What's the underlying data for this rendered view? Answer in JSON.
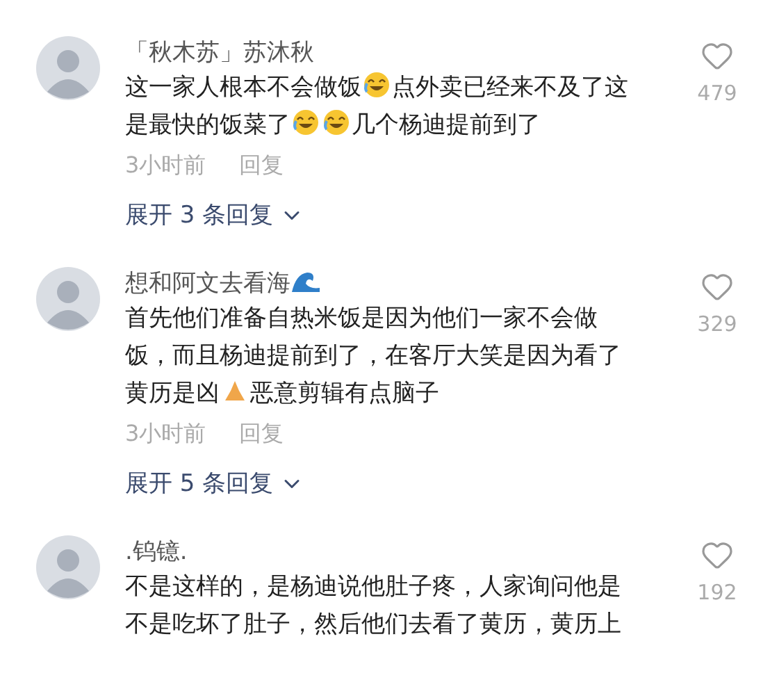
{
  "comments": [
    {
      "username": [
        {
          "kind": "text",
          "text": "「秋木苏」苏沐秋"
        }
      ],
      "lines": [
        [
          {
            "kind": "text",
            "text": "这一家人根本不会做饭"
          },
          {
            "kind": "emoji-laugh"
          },
          {
            "kind": "text",
            "text": "点外卖已经来不及了这"
          }
        ],
        [
          {
            "kind": "text",
            "text": "是最快的饭菜了"
          },
          {
            "kind": "emoji-laugh"
          },
          {
            "kind": "emoji-laugh"
          },
          {
            "kind": "text",
            "text": "几个杨迪提前到了"
          }
        ]
      ],
      "time": "3小时前",
      "reply": "回复",
      "expand": "展开 3 条回复",
      "likes": "479"
    },
    {
      "username": [
        {
          "kind": "text",
          "text": "想和阿文去看海"
        },
        {
          "kind": "emoji-wave"
        }
      ],
      "lines": [
        [
          {
            "kind": "text",
            "text": "首先他们准备自热米饭是因为他们一家不会做"
          }
        ],
        [
          {
            "kind": "text",
            "text": "饭，而且杨迪提前到了，在客厅大笑是因为看了"
          }
        ],
        [
          {
            "kind": "text",
            "text": "黄历是凶"
          },
          {
            "kind": "emoji-pray"
          },
          {
            "kind": "text",
            "text": "恶意剪辑有点脑子"
          }
        ]
      ],
      "time": "3小时前",
      "reply": "回复",
      "expand": "展开 5 条回复",
      "likes": "329"
    },
    {
      "username": [
        {
          "kind": "text",
          "text": ".钨镱."
        }
      ],
      "lines": [
        [
          {
            "kind": "text",
            "text": "不是这样的，是杨迪说他肚子疼，人家询问他是"
          }
        ],
        [
          {
            "kind": "text",
            "text": "不是吃坏了肚子，然后他们去看了黄历，黄历上"
          }
        ]
      ],
      "likes": "192"
    }
  ]
}
